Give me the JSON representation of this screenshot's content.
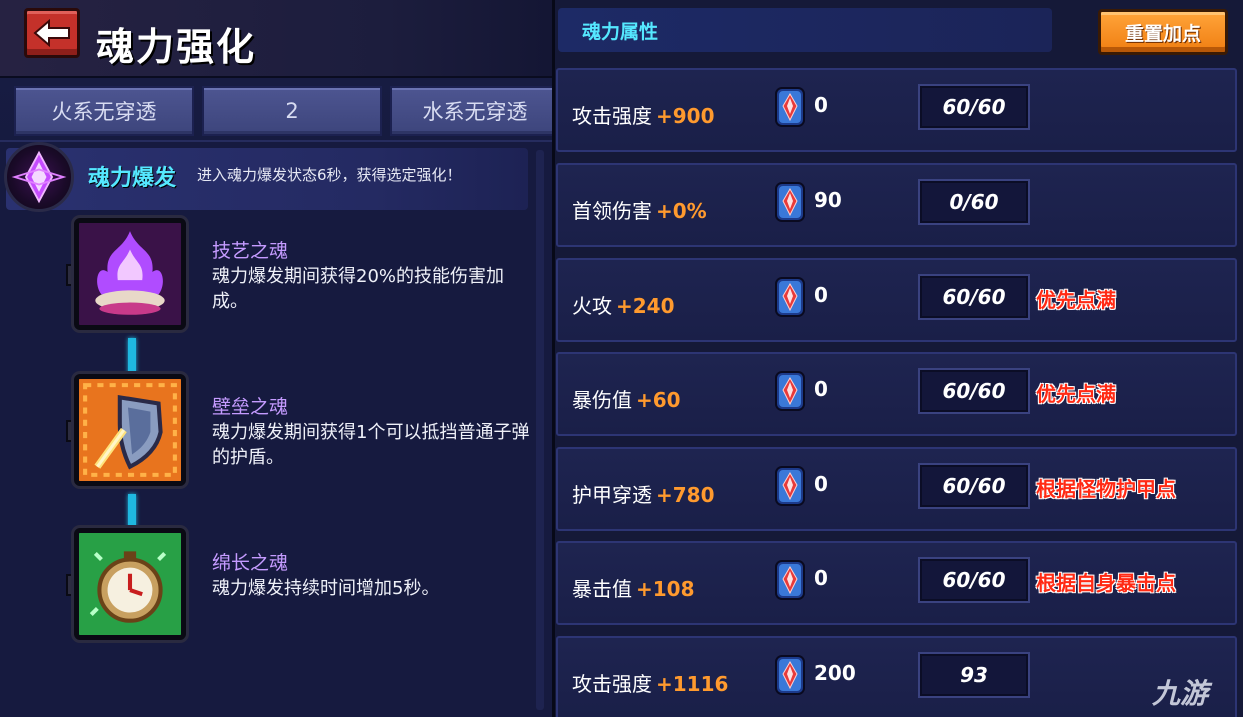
{
  "header": {
    "title": "魂力强化"
  },
  "tabs": [
    "火系无穿透",
    "2",
    "水系无穿透"
  ],
  "skill": {
    "name": "魂力爆发",
    "description": "进入魂力爆发状态6秒，获得选定强化！"
  },
  "souls": [
    {
      "title": "技艺之魂",
      "desc": "魂力爆发期间获得20%的技能伤害加成。"
    },
    {
      "title": "壁垒之魂",
      "desc": "魂力爆发期间获得1个可以抵挡普通子弹的护盾。"
    },
    {
      "title": "绵长之魂",
      "desc": "魂力爆发持续时间增加5秒。"
    }
  ],
  "attributes": {
    "header": "魂力属性",
    "reset_label": "重置加点",
    "rows": [
      {
        "name": "攻击强度",
        "bonus": "+900",
        "count": "0",
        "level": "60/60",
        "note": ""
      },
      {
        "name": "首领伤害",
        "bonus": "+0%",
        "count": "90",
        "level": "0/60",
        "note": ""
      },
      {
        "name": "火攻",
        "bonus": "+240",
        "count": "0",
        "level": "60/60",
        "note": "优先点满"
      },
      {
        "name": "暴伤值",
        "bonus": "+60",
        "count": "0",
        "level": "60/60",
        "note": "优先点满"
      },
      {
        "name": "护甲穿透",
        "bonus": "+780",
        "count": "0",
        "level": "60/60",
        "note": "根据怪物护甲点"
      },
      {
        "name": "暴击值",
        "bonus": "+108",
        "count": "0",
        "level": "60/60",
        "note": "根据自身暴击点"
      },
      {
        "name": "攻击强度",
        "bonus": "+1116",
        "count": "200",
        "level": "93",
        "note": ""
      }
    ]
  },
  "watermark": "九游",
  "colors": {
    "accent_cyan": "#55e8ff",
    "bonus_orange": "#ff9a2e",
    "note_red": "#ff2a14",
    "reset_orange": "#f07e12",
    "back_red": "#c4312a",
    "soul_title_purple": "#c59bff"
  },
  "icons": {
    "back": "left-arrow-icon",
    "skill": "soul-burst-crystal-icon",
    "souls": [
      "purple-flame-icon",
      "shield-icon",
      "stopwatch-icon"
    ],
    "gem": "soul-gem-icon"
  }
}
